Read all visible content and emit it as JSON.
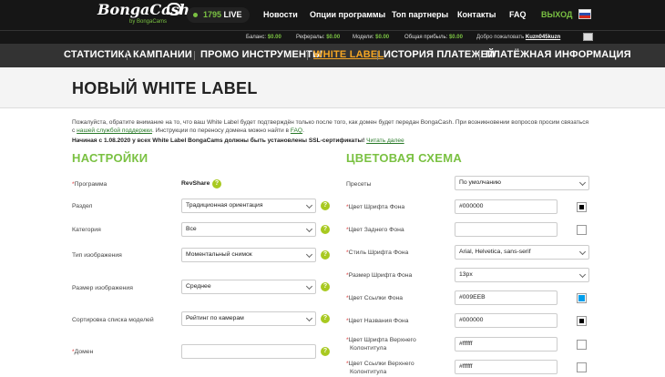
{
  "header": {
    "logo_text": "BongaCash",
    "logo_subtext": "by BongaCams",
    "live_count": "1795",
    "live_label": "LIVE",
    "nav": [
      "Новости",
      "Опции программы",
      "Топ партнеры",
      "Контакты",
      "FAQ",
      "ВЫХОД"
    ]
  },
  "infobar": {
    "balance_label": "Баланс:",
    "balance_value": "$0.00",
    "referrals_label": "Рефералы:",
    "referrals_value": "$0.00",
    "models_label": "Модели:",
    "models_value": "$0.00",
    "profit_label": "Общая прибыль:",
    "profit_value": "$0.00",
    "welcome": "Добро пожаловать",
    "username": "Kuzn045kuzn"
  },
  "mainnav": {
    "items": [
      "СТАТИСТИКА",
      "КАМПАНИИ",
      "ПРОМО ИНСТРУМЕНТЫ",
      "WHITE LABEL",
      "ИСТОРИЯ ПЛАТЕЖЕЙ",
      "ПЛАТЁЖНАЯ ИНФОРМАЦИЯ"
    ],
    "active": "WHITE LABEL"
  },
  "page": {
    "title": "НОВЫЙ WHITE LABEL",
    "notice1": "Пожалуйста, обратите внимание на то, что ваш White Label будет подтверждён только после того, как домен будет передан BongaCash. При возникновении вопросов просим связаться",
    "notice2_prefix": "с ",
    "notice2_link": "нашей службой поддержки",
    "notice2_suffix": ". Инструкции по переносу домена можно найти в ",
    "notice2_faq": "FAQ",
    "notice3": "Начиная с 1.08.2020 у всех White Label BongaCams должны быть установлены SSL-сертификаты!",
    "notice3_link": "Читать далее"
  },
  "settings": {
    "heading": "НАСТРОЙКИ",
    "program_label": "Программа",
    "program_value": "RevShare",
    "section_label": "Раздел",
    "section_value": "Традиционная ориентация",
    "category_label": "Категория",
    "category_value": "Все",
    "image_type_label": "Тип изображения",
    "image_type_value": "Моментальный снимок",
    "image_size_label": "Размер изображения",
    "image_size_value": "Среднее",
    "sort_label": "Сортировка списка моделей",
    "sort_value": "Рейтинг по камерам",
    "domain_label": "Домен",
    "domain_value": ""
  },
  "colors": {
    "heading": "ЦВЕТОВАЯ СХЕМА",
    "presets_label": "Пресеты",
    "presets_value": "По умолчанию",
    "font_color_label": "Цвет Шрифта Фона",
    "font_color_value": "#000000",
    "bg_color_label": "Цвет Заднего Фона",
    "bg_color_value": "",
    "font_style_label": "Стиль Шрифта Фона",
    "font_style_value": "Arial, Helvetica, sans-serif",
    "font_size_label": "Размер Шрифта Фона",
    "font_size_value": "13px",
    "link_color_label": "Цвет Ссылки Фона",
    "link_color_value": "#009EEB",
    "title_color_label": "Цвет Названия Фона",
    "title_color_value": "#000000",
    "header_font_label_1": "Цвет Шрифта Верхнего",
    "header_font_label_2": "Колонтитула",
    "header_font_value": "#ffffff",
    "header_link_label_1": "Цвет Ссылки Верхнего",
    "header_link_label_2": "Колонтитула",
    "header_link_value": "#ffffff"
  },
  "theme": {
    "accent": "#7ac142",
    "active_nav": "#f5a623",
    "help_badge": "#a8c920",
    "swatch_black": "#000000",
    "swatch_link": "#009EEB"
  }
}
